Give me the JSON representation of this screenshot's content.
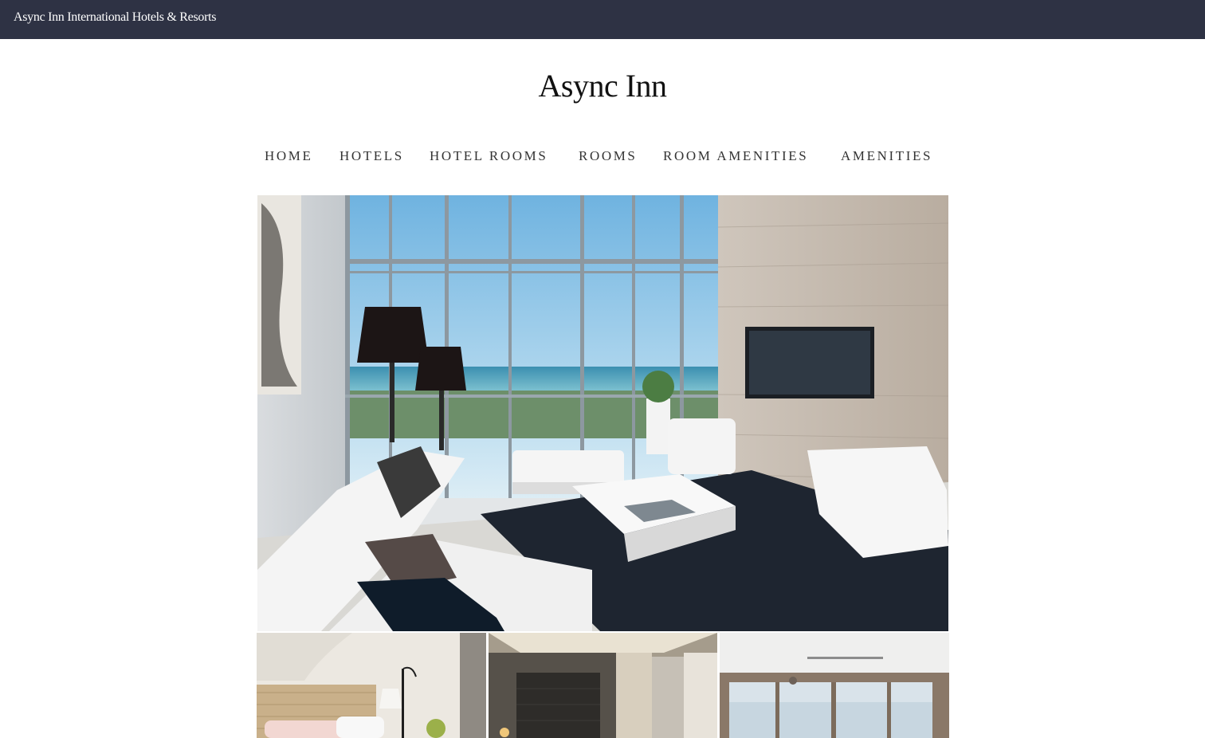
{
  "topbar": {
    "title": "Async Inn International Hotels & Resorts"
  },
  "header": {
    "site_title": "Async Inn"
  },
  "nav": {
    "items": [
      {
        "label": "HOME"
      },
      {
        "label": "HOTELS"
      },
      {
        "label": "HOTEL ROOMS"
      },
      {
        "label": "ROOMS"
      },
      {
        "label": "ROOM AMENITIES"
      },
      {
        "label": "AMENITIES"
      }
    ]
  },
  "gallery": {
    "hero_alt": "Living room with ocean view",
    "thumbnails": [
      {
        "alt": "Bedroom with woven headboard"
      },
      {
        "alt": "Hotel room with dark headboard"
      },
      {
        "alt": "Room with balcony view"
      }
    ]
  },
  "colors": {
    "topbar_bg": "#2e3244",
    "topbar_text": "#ffffff",
    "nav_text": "#333333",
    "title_text": "#111111"
  }
}
